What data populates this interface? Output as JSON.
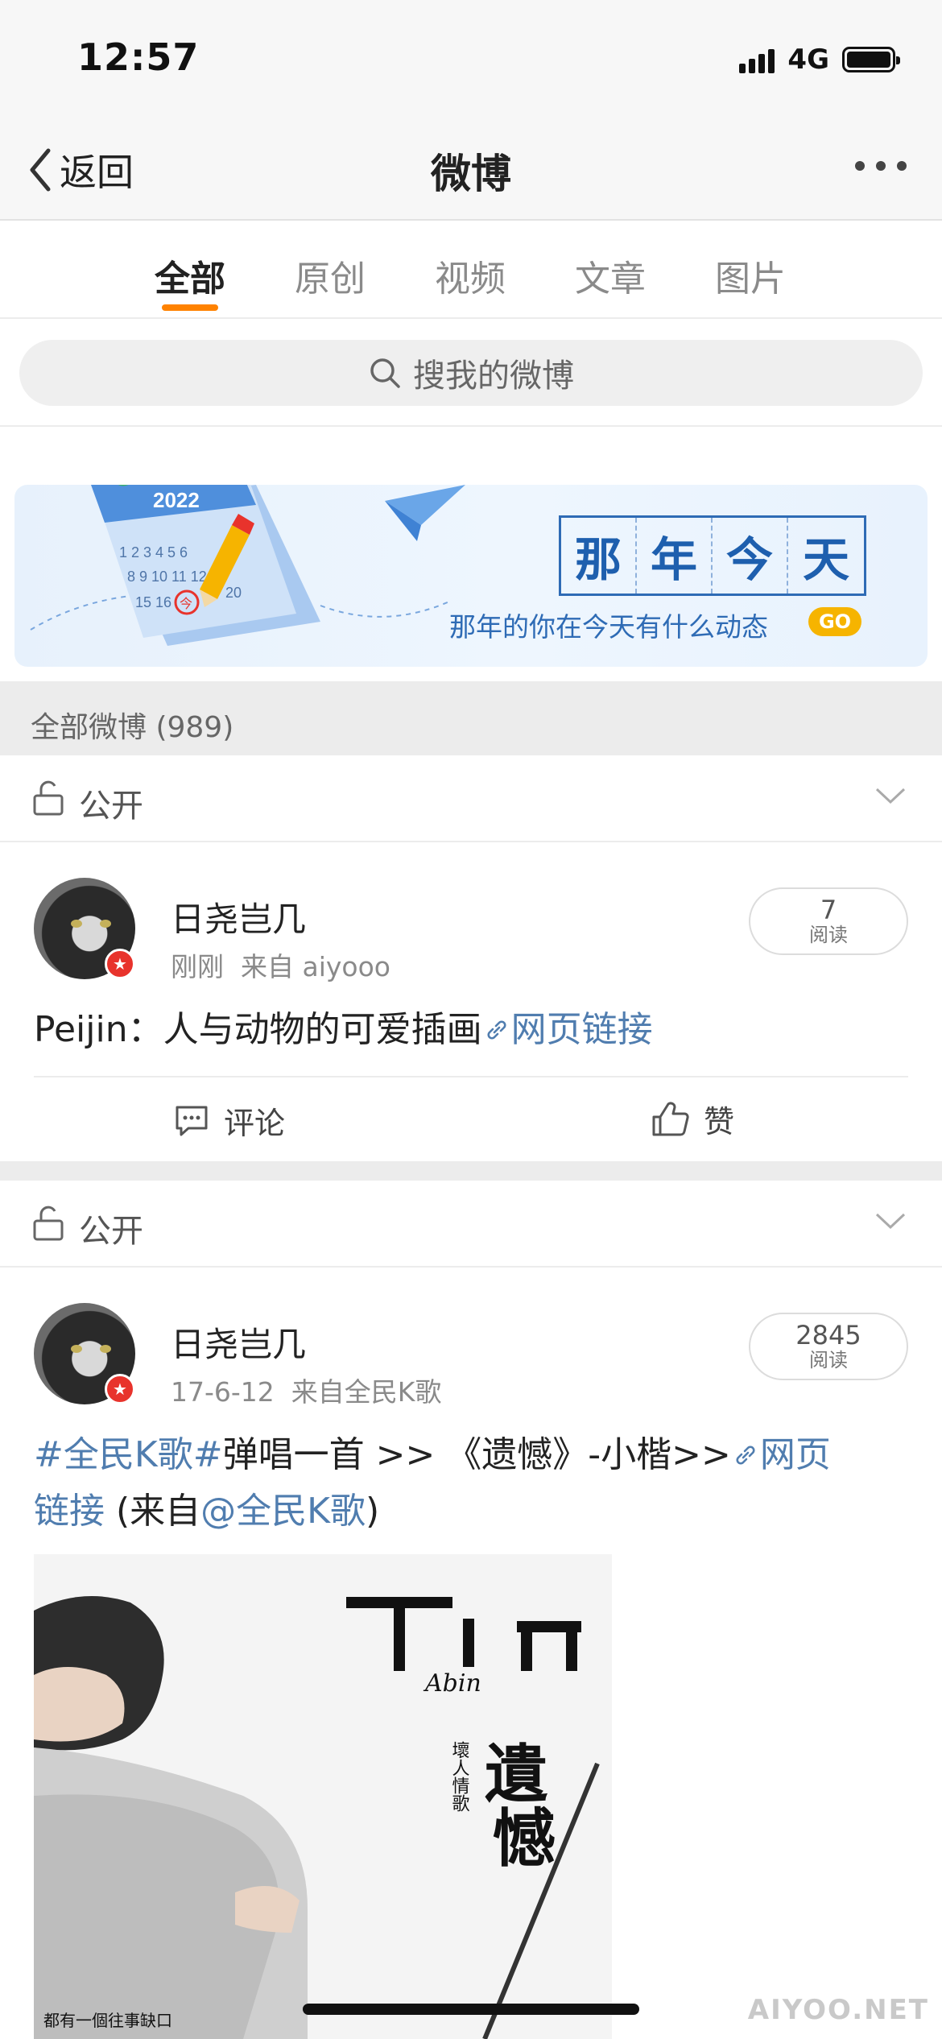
{
  "status_bar": {
    "time": "12:57",
    "network": "4G"
  },
  "nav": {
    "back_label": "返回",
    "title": "微博"
  },
  "tabs": [
    {
      "label": "全部",
      "active": true
    },
    {
      "label": "原创",
      "active": false
    },
    {
      "label": "视频",
      "active": false
    },
    {
      "label": "文章",
      "active": false
    },
    {
      "label": "图片",
      "active": false
    }
  ],
  "search": {
    "placeholder": "搜我的微博"
  },
  "banner": {
    "title_chars": [
      "那",
      "年",
      "今",
      "天"
    ],
    "subtitle": "那年的你在今天有什么动态",
    "go_label": "GO",
    "calendar_year": "2022",
    "calendar_today": "今"
  },
  "section": {
    "title": "全部微博 (989)"
  },
  "posts": [
    {
      "visibility": "公开",
      "user": "日尧岂几",
      "time": "刚刚",
      "source": "来自 aiyooo",
      "reads_count": "7",
      "reads_label": "阅读",
      "text_plain": "Peijin：人与动物的可爱插画",
      "link_text": "网页链接",
      "comment_label": "评论",
      "like_label": "赞"
    },
    {
      "visibility": "公开",
      "user": "日尧岂几",
      "time": "17-6-12",
      "source": "来自全民K歌",
      "reads_count": "2845",
      "reads_label": "阅读",
      "topic": "#全民K歌#",
      "text_plain": "弹唱一首 >> 《遗憾》-小楷>>",
      "link_text_1": "网页",
      "link_text_2": "链接",
      "from_prefix": " (来自",
      "mention": "@全民K歌",
      "from_suffix": ")",
      "image_text": {
        "artist": "Abin",
        "title_1": "遺",
        "title_2": "憾",
        "tagline": "壞人情歌",
        "bottom": "都有一個往事缺口"
      }
    }
  ],
  "watermark": "AIYOO.NET",
  "colors": {
    "accent": "#ff8200",
    "link": "#507daf",
    "vip": "#e8332c",
    "banner_blue": "#1e5fae"
  }
}
